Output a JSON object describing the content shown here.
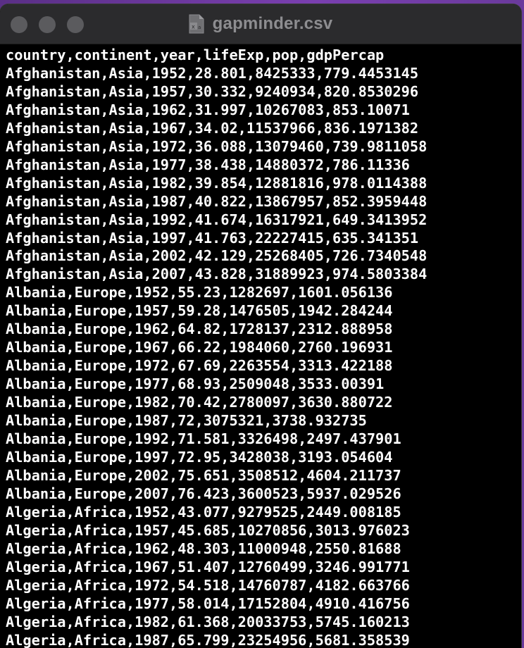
{
  "window": {
    "title": "gapminder.csv",
    "icon": "csv-document-icon",
    "background": "#000000",
    "text_color": "#ffffff"
  },
  "file_lines": [
    "country,continent,year,lifeExp,pop,gdpPercap",
    "Afghanistan,Asia,1952,28.801,8425333,779.4453145",
    "Afghanistan,Asia,1957,30.332,9240934,820.8530296",
    "Afghanistan,Asia,1962,31.997,10267083,853.10071",
    "Afghanistan,Asia,1967,34.02,11537966,836.1971382",
    "Afghanistan,Asia,1972,36.088,13079460,739.9811058",
    "Afghanistan,Asia,1977,38.438,14880372,786.11336",
    "Afghanistan,Asia,1982,39.854,12881816,978.0114388",
    "Afghanistan,Asia,1987,40.822,13867957,852.3959448",
    "Afghanistan,Asia,1992,41.674,16317921,649.3413952",
    "Afghanistan,Asia,1997,41.763,22227415,635.341351",
    "Afghanistan,Asia,2002,42.129,25268405,726.7340548",
    "Afghanistan,Asia,2007,43.828,31889923,974.5803384",
    "Albania,Europe,1952,55.23,1282697,1601.056136",
    "Albania,Europe,1957,59.28,1476505,1942.284244",
    "Albania,Europe,1962,64.82,1728137,2312.888958",
    "Albania,Europe,1967,66.22,1984060,2760.196931",
    "Albania,Europe,1972,67.69,2263554,3313.422188",
    "Albania,Europe,1977,68.93,2509048,3533.00391",
    "Albania,Europe,1982,70.42,2780097,3630.880722",
    "Albania,Europe,1987,72,3075321,3738.932735",
    "Albania,Europe,1992,71.581,3326498,2497.437901",
    "Albania,Europe,1997,72.95,3428038,3193.054604",
    "Albania,Europe,2002,75.651,3508512,4604.211737",
    "Albania,Europe,2007,76.423,3600523,5937.029526",
    "Algeria,Africa,1952,43.077,9279525,2449.008185",
    "Algeria,Africa,1957,45.685,10270856,3013.976023",
    "Algeria,Africa,1962,48.303,11000948,2550.81688",
    "Algeria,Africa,1967,51.407,12760499,3246.991771",
    "Algeria,Africa,1972,54.518,14760787,4182.663766",
    "Algeria,Africa,1977,58.014,17152804,4910.416756",
    "Algeria,Africa,1982,61.368,20033753,5745.160213",
    "Algeria,Africa,1987,65.799,23254956,5681.358539"
  ]
}
